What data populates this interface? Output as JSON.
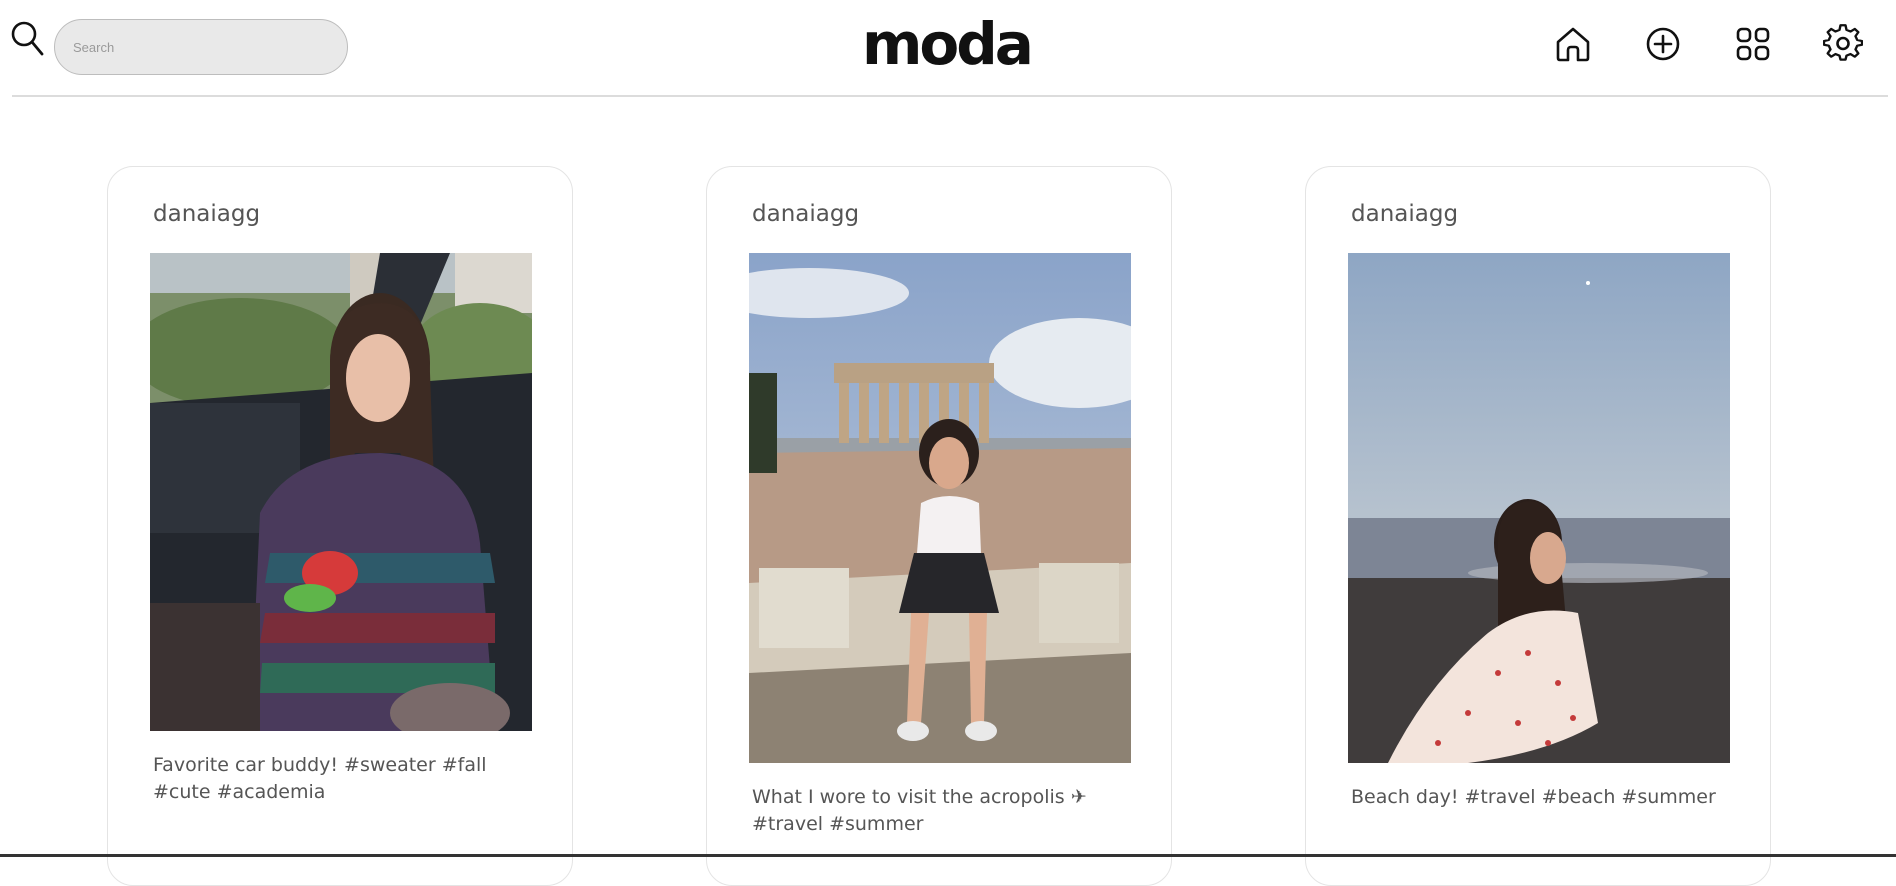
{
  "header": {
    "brand": "moda",
    "search": {
      "placeholder": "Search",
      "value": ""
    },
    "icons": [
      "search-icon",
      "home-icon",
      "add-circle-icon",
      "grid-icon",
      "gear-icon"
    ]
  },
  "posts": [
    {
      "username": "danaiagg",
      "caption": "Favorite car buddy! #sweater #fall #cute #academia",
      "photo": "girl in car holding caterpillar plush"
    },
    {
      "username": "danaiagg",
      "caption": "What I wore to visit the acropolis ✈ #travel #summer",
      "photo": "girl sitting on stones in front of Parthenon"
    },
    {
      "username": "danaiagg",
      "caption": "Beach day! #travel #beach #summer",
      "photo": "girl on beach at sunset"
    }
  ],
  "colors": {
    "background": "#ffffff",
    "text": "#555555",
    "brand": "#111111",
    "search_bg": "#e9e9e9"
  }
}
